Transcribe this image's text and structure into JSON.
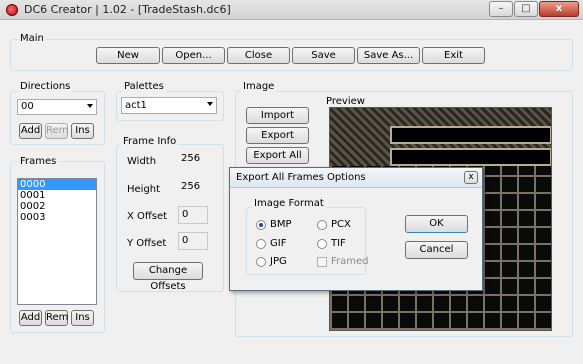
{
  "window": {
    "title": "DC6 Creator | 1.02 - [TradeStash.dc6]",
    "controls": {
      "minimize": "–",
      "maximize": "□",
      "close": "x"
    }
  },
  "main": {
    "label": "Main",
    "buttons": [
      "New",
      "Open...",
      "Close",
      "Save",
      "Save As...",
      "Exit"
    ]
  },
  "directions": {
    "label": "Directions",
    "selected": "00",
    "buttons": [
      "Add",
      "Rem",
      "Ins"
    ]
  },
  "frames": {
    "label": "Frames",
    "items": [
      "0000",
      "0001",
      "0002",
      "0003"
    ],
    "selected_index": 0,
    "buttons": [
      "Add",
      "Rem",
      "Ins"
    ]
  },
  "palettes": {
    "label": "Palettes",
    "selected": "act1"
  },
  "frame_info": {
    "label": "Frame Info",
    "width_label": "Width",
    "width": "256",
    "height_label": "Height",
    "height": "256",
    "xoffset_label": "X Offset",
    "xoffset": "0",
    "yoffset_label": "Y Offset",
    "yoffset": "0",
    "change_offsets": "Change Offsets"
  },
  "image": {
    "label": "Image",
    "buttons": [
      "Import",
      "Export",
      "Export All"
    ],
    "preview_label": "Preview"
  },
  "dialog": {
    "title": "Export All Frames Options",
    "close": "x",
    "group_label": "Image Format",
    "options": [
      "BMP",
      "PCX",
      "GIF",
      "TIF",
      "JPG"
    ],
    "selected": "BMP",
    "framed_label": "Framed",
    "ok": "OK",
    "cancel": "Cancel"
  },
  "colors": {
    "selection": "#3399ff",
    "close_button": "#c0392b"
  }
}
